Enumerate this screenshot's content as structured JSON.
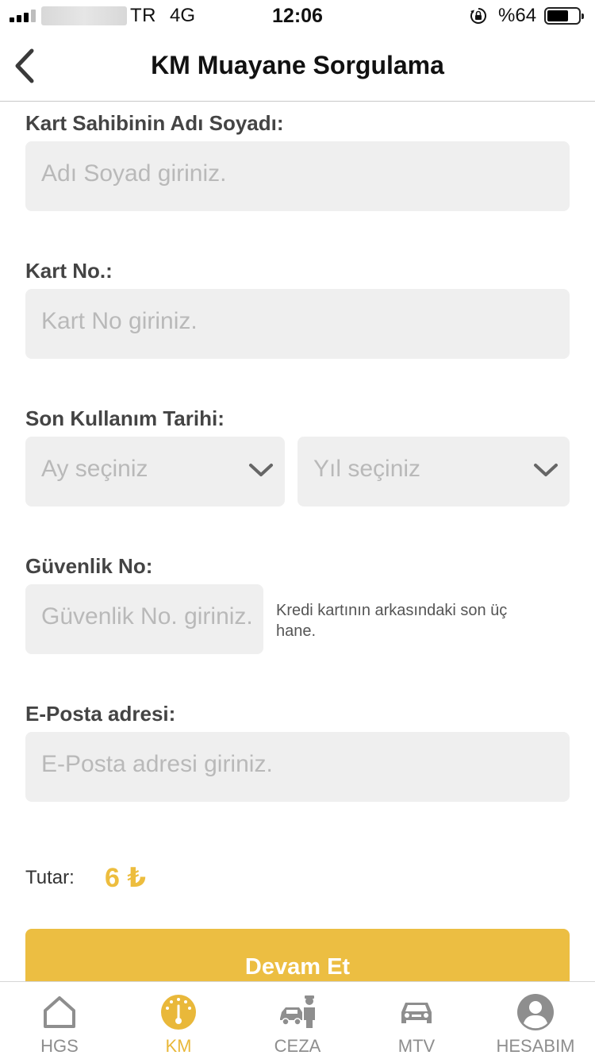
{
  "status_bar": {
    "carrier": "TR",
    "network": "4G",
    "time": "12:06",
    "battery_percent": "%64",
    "battery_level": 0.64
  },
  "nav": {
    "title": "KM Muayane Sorgulama",
    "back_icon": "chevron-left-icon"
  },
  "form": {
    "name": {
      "label": "Kart Sahibinin Adı Soyadı:",
      "placeholder": "Adı Soyad giriniz.",
      "value": ""
    },
    "card_no": {
      "label": "Kart No.:",
      "placeholder": "Kart No giriniz.",
      "value": ""
    },
    "expiry": {
      "label": "Son Kullanım Tarihi:",
      "month_placeholder": "Ay seçiniz",
      "year_placeholder": "Yıl seçiniz"
    },
    "security": {
      "label": "Güvenlik No:",
      "placeholder": "Güvenlik No. giriniz.",
      "hint": "Kredi kartının arkasındaki son üç hane."
    },
    "email": {
      "label": "E-Posta adresi:",
      "placeholder": "E-Posta adresi giriniz.",
      "value": ""
    }
  },
  "total": {
    "label": "Tutar:",
    "value": "6 ₺"
  },
  "cta": {
    "label": "Devam Et"
  },
  "tabs": [
    {
      "label": "HGS",
      "icon": "home-icon",
      "active": false
    },
    {
      "label": "KM",
      "icon": "gauge-icon",
      "active": true
    },
    {
      "label": "CEZA",
      "icon": "police-car-icon",
      "active": false
    },
    {
      "label": "MTV",
      "icon": "car-icon",
      "active": false
    },
    {
      "label": "HESABIM",
      "icon": "user-icon",
      "active": false
    }
  ],
  "colors": {
    "accent": "#ecbe42",
    "field_bg": "#efefef",
    "placeholder": "#b9b9b9",
    "tab_inactive": "#8e8e8e"
  }
}
